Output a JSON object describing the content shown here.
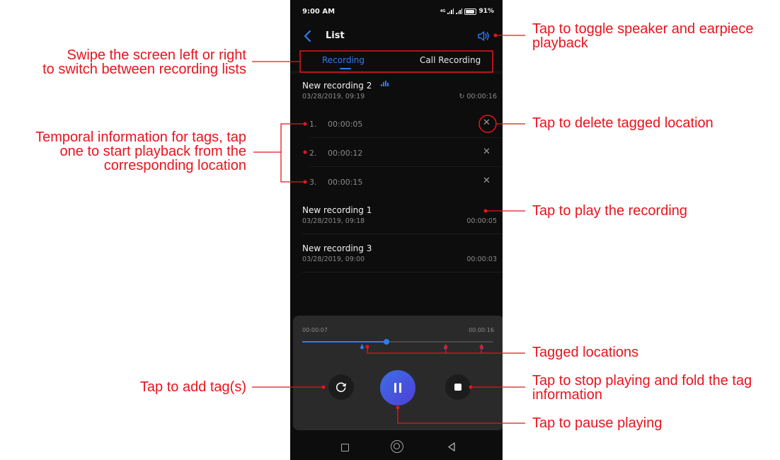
{
  "status_bar": {
    "time": "9:00 AM",
    "network": "4G",
    "battery": "91%"
  },
  "header": {
    "title": "List"
  },
  "tabs": [
    {
      "label": "Recording",
      "active": true
    },
    {
      "label": "Call Recording",
      "active": false
    }
  ],
  "recordings": [
    {
      "title": "New recording 2",
      "date": "03/28/2019, 09:19",
      "duration": "00:00:16",
      "playing": true,
      "tags": [
        {
          "index": "1.",
          "time": "00:00:05"
        },
        {
          "index": "2.",
          "time": "00:00:12"
        },
        {
          "index": "3.",
          "time": "00:00:15"
        }
      ]
    },
    {
      "title": "New recording 1",
      "date": "03/28/2019, 09:18",
      "duration": "00:00:05"
    },
    {
      "title": "New recording 3",
      "date": "03/28/2019, 09:00",
      "duration": "00:00:03"
    }
  ],
  "player": {
    "current_time": "00:00:07",
    "total_time": "00:00:16",
    "progress": 0.44,
    "tag_positions": [
      0.3125,
      0.75,
      0.9375
    ]
  },
  "annotations": {
    "speaker": "Tap to toggle speaker and earpiece\nplayback",
    "swipe": "Swipe the screen left or right\nto switch between recording lists",
    "delete_tag": "Tap to delete tagged location",
    "temporal": "Temporal information for tags, tap\none to start playback from the\ncorresponding location",
    "play": "Tap to play the recording",
    "tagged_locations": "Tagged locations",
    "add_tag": "Tap to add tag(s)",
    "stop": "Tap to stop playing and fold the tag\ninformation",
    "pause": "Tap to pause playing"
  },
  "colors": {
    "accent": "#2d7df5",
    "annotation": "#e8141e",
    "background": "#0d0d0d"
  }
}
